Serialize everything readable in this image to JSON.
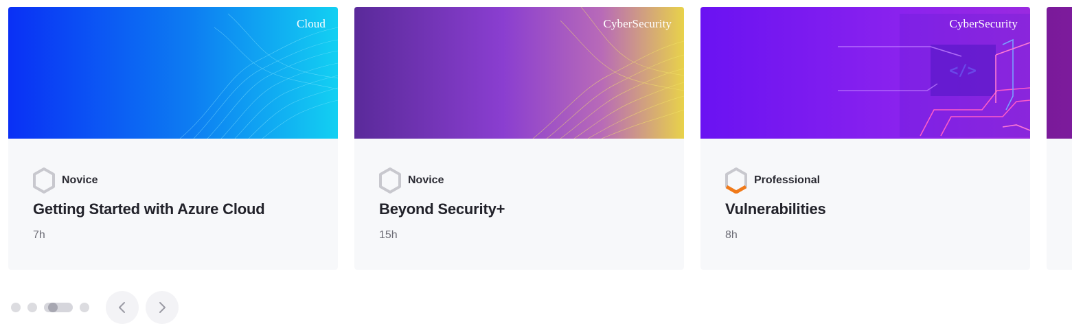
{
  "cards": [
    {
      "tag": "Cloud",
      "level": "Novice",
      "title": "Getting Started with Azure Cloud",
      "duration": "7h",
      "level_icon": "hexagon-outline-icon",
      "colors": {
        "from": "#0a3cf5",
        "to": "#12c8f0",
        "wave": "#7fe6ff"
      }
    },
    {
      "tag": "CyberSecurity",
      "level": "Novice",
      "title": "Beyond Security+",
      "duration": "15h",
      "level_icon": "hexagon-outline-icon",
      "colors": {
        "from": "#5e2aa8",
        "to": "#e8d552",
        "wave": "#f5e66a"
      }
    },
    {
      "tag": "CyberSecurity",
      "level": "Professional",
      "title": "Vulnerabilities",
      "duration": "8h",
      "level_icon": "hexagon-half-filled-icon",
      "colors": {
        "from": "#6a14f0",
        "to": "#a02ae8",
        "wave": "#ff5cc8"
      }
    }
  ],
  "pagination": {
    "total": 4,
    "active_index": 2
  },
  "nav": {
    "prev_icon": "chevron-left-icon",
    "next_icon": "chevron-right-icon"
  },
  "colors": {
    "card_bg": "#f7f8fa",
    "professional_accent": "#f07a1a",
    "hexagon_outline": "#c8c8ce"
  }
}
